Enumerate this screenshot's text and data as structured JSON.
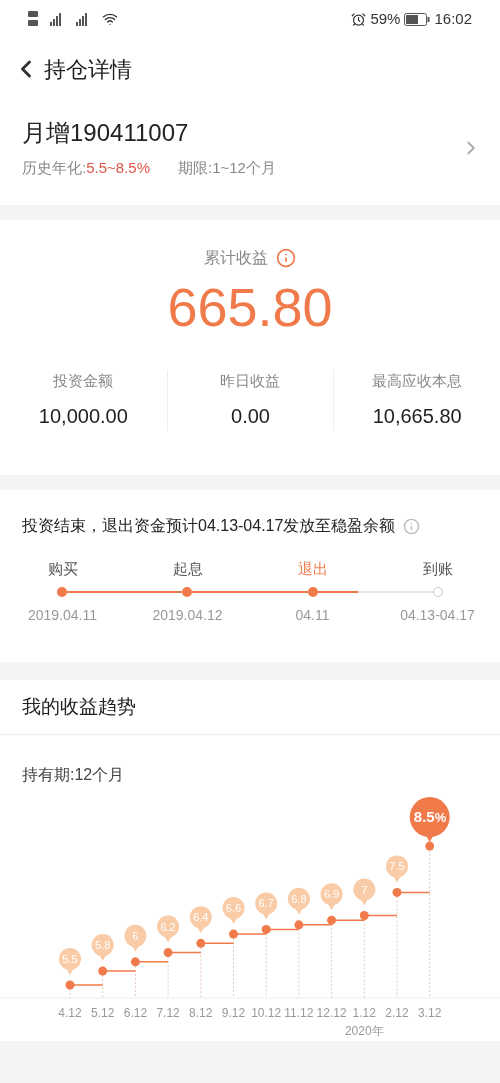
{
  "status_bar": {
    "battery": "59%",
    "time": "16:02"
  },
  "header": {
    "title": "持仓详情"
  },
  "product": {
    "name": "月增190411007",
    "rate_label": "历史年化:",
    "rate": "5.5~8.5%",
    "term": "期限:1~12个月"
  },
  "earnings": {
    "label": "累计收益",
    "total": "665.80",
    "stats": [
      {
        "label": "投资金额",
        "value": "10,000.00"
      },
      {
        "label": "昨日收益",
        "value": "0.00"
      },
      {
        "label": "最高应收本息",
        "value": "10,665.80"
      }
    ]
  },
  "progress": {
    "notice": "投资结束，退出资金预计04.13-04.17发放至稳盈余额",
    "steps": [
      {
        "label": "购买",
        "date": "2019.04.11",
        "done": true,
        "selected": false
      },
      {
        "label": "起息",
        "date": "2019.04.12",
        "done": true,
        "selected": false
      },
      {
        "label": "退出",
        "date": "04.11",
        "done": true,
        "selected": true
      },
      {
        "label": "到账",
        "date": "04.13-04.17",
        "done": false,
        "selected": false
      }
    ]
  },
  "trend": {
    "title": "我的收益趋势",
    "period": "持有期:12个月",
    "year_label": "2020年",
    "chart_data": {
      "type": "scatter",
      "categories": [
        "4.12",
        "5.12",
        "6.12",
        "7.12",
        "8.12",
        "9.12",
        "10.12",
        "11.12",
        "12.12",
        "1.12",
        "2.12",
        "3.12"
      ],
      "series": [
        {
          "color": "#f07a4a",
          "values": [
            5.5,
            5.8,
            6,
            6.2,
            6.4,
            6.6,
            6.7,
            6.8,
            6.9,
            7,
            7.5,
            8.5
          ]
        }
      ],
      "data_labels": true,
      "value_labels": [
        "5.5",
        "5.8",
        "6",
        "6.2",
        "6.4",
        "6.6",
        "6.7",
        "6.8",
        "6.9",
        "7",
        "7.5",
        "8.5"
      ]
    },
    "peak_unit": "%"
  }
}
